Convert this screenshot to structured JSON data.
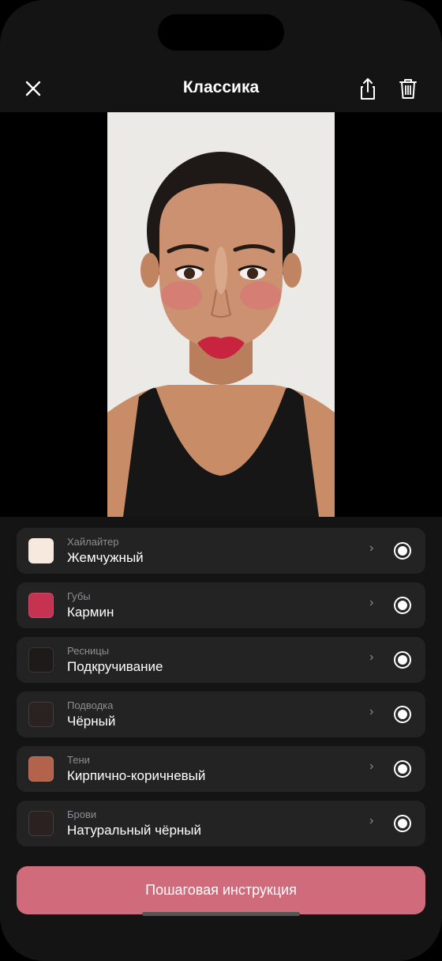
{
  "header": {
    "title": "Классика",
    "close_icon": "close-icon",
    "share_icon": "share-icon",
    "delete_icon": "trash-icon"
  },
  "photo": {
    "description_icon": "portrait"
  },
  "items": [
    {
      "category": "Хайлайтер",
      "value": "Жемчужный",
      "color": "#F8E9DE",
      "selected": true
    },
    {
      "category": "Губы",
      "value": "Кармин",
      "color": "#C63352",
      "selected": true
    },
    {
      "category": "Ресницы",
      "value": "Подкручивание",
      "color": "#1D1A19",
      "selected": true
    },
    {
      "category": "Подводка",
      "value": "Чёрный",
      "color": "#2A2220",
      "selected": true
    },
    {
      "category": "Тени",
      "value": "Кирпично-коричневый",
      "color": "#B3634B",
      "selected": true
    },
    {
      "category": "Брови",
      "value": "Натуральный чёрный",
      "color": "#2A2220",
      "selected": true
    }
  ],
  "cta": {
    "label": "Пошаговая инструкция"
  },
  "colors": {
    "accent": "#D06B7B",
    "background": "#141414",
    "card": "#232323"
  }
}
